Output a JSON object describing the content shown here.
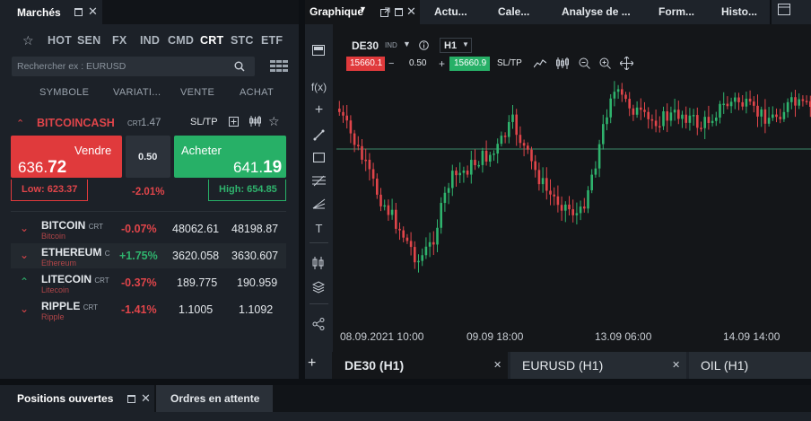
{
  "markets": {
    "title": "Marchés",
    "categories": [
      "HOT",
      "SEN",
      "FX",
      "IND",
      "CMD",
      "CRT",
      "STC",
      "ETF"
    ],
    "active_category": "CRT",
    "search_placeholder": "Rechercher ex : EURUSD",
    "columns": [
      "SYMBOLE",
      "VARIATI...",
      "VENTE",
      "ACHAT"
    ],
    "selected": {
      "symbol": "BITCOINCASH",
      "tag": "CRT",
      "spread_small": "1.47",
      "sltp": "SL/TP",
      "sell_label": "Vendre",
      "sell_price_main": "636.",
      "sell_price_big": "72",
      "buy_label": "Acheter",
      "buy_price_main": "641.",
      "buy_price_big": "19",
      "spread": "0.50",
      "low": "Low: 623.37",
      "change": "-2.01%",
      "high": "High: 654.85"
    },
    "rows": [
      {
        "name": "BITCOIN",
        "tag": "CRT",
        "sub": "Bitcoin",
        "change": "-0.07%",
        "dir": "down",
        "sell": "48062.61",
        "buy": "48198.87"
      },
      {
        "name": "ETHEREUM",
        "tag": "C",
        "sub": "Ethereum",
        "change": "+1.75%",
        "dir": "up",
        "sell": "3620.058",
        "buy": "3630.607"
      },
      {
        "name": "LITECOIN",
        "tag": "CRT",
        "sub": "Litecoin",
        "change": "-0.37%",
        "dir": "up",
        "sell": "189.775",
        "buy": "190.959"
      },
      {
        "name": "RIPPLE",
        "tag": "CRT",
        "sub": "Ripple",
        "change": "-1.41%",
        "dir": "down",
        "sell": "1.1005",
        "buy": "1.1092"
      }
    ]
  },
  "chart_tabs": {
    "main": "Graphique",
    "others": [
      "Actu...",
      "Cale...",
      "Analyse de ...",
      "Form...",
      "Histo..."
    ]
  },
  "chart": {
    "symbol": "DE30",
    "symbol_tag": "IND",
    "timeframe": "H1",
    "sell_price": "15660.1",
    "spread": "0.50",
    "buy_price": "15660.9",
    "sltp": "SL/TP",
    "fx_label": "f(x)",
    "x_labels": [
      "08.09.2021 10:00",
      "09.09 18:00",
      "13.09 06:00",
      "14.09 14:00"
    ],
    "colors": {
      "up": "#2fb36d",
      "down": "#e0454a",
      "current_line": "#3d8a6a"
    }
  },
  "bottom_tabs": [
    {
      "label": "DE30 (H1)",
      "active": true
    },
    {
      "label": "EURUSD (H1)",
      "active": false
    },
    {
      "label": "OIL (H1)",
      "active": false
    }
  ],
  "bottom_panel": {
    "tabs": [
      "Positions ouvertes",
      "Ordres en attente"
    ]
  }
}
